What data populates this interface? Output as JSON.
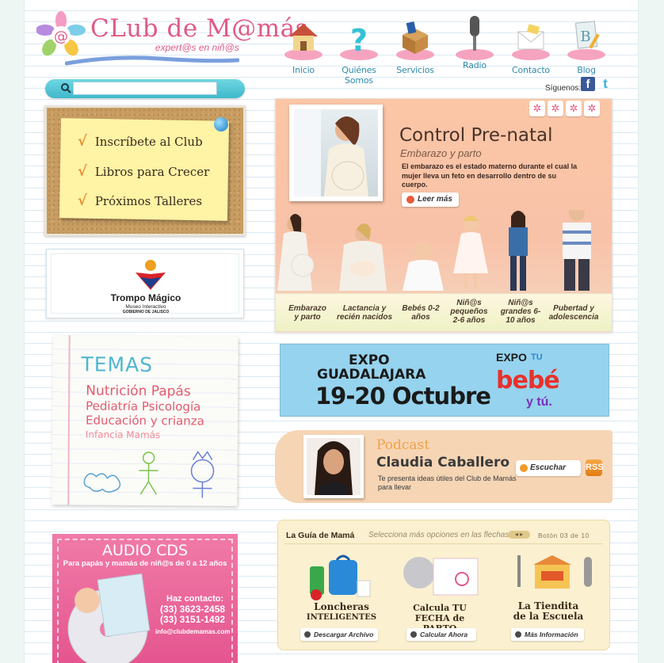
{
  "header": {
    "logo_title": "CLub de M@más",
    "logo_tagline": "expert@s en niñ@s",
    "nav": [
      {
        "label": "Inicio",
        "icon": "house-icon"
      },
      {
        "label": "Quiénes Somos",
        "icon": "question-mark-icon"
      },
      {
        "label": "Servicios",
        "icon": "box-icon"
      },
      {
        "label": "Radio",
        "icon": "microphone-icon"
      },
      {
        "label": "Contacto",
        "icon": "envelope-icon"
      },
      {
        "label": "Blog",
        "icon": "notebook-icon"
      }
    ]
  },
  "search": {
    "placeholder": "",
    "value": ""
  },
  "social": {
    "label": "Síguenos:",
    "facebook": "f",
    "twitter": "t"
  },
  "bulletin": {
    "links": [
      "Inscríbete al Club",
      "Libros para Crecer",
      "Próximos Talleres"
    ],
    "check": "√"
  },
  "trompo": {
    "name": "Trompo Mágico",
    "subtitle": "Museo Interactivo",
    "subtitle2": "GOBIERNO DE JALISCO"
  },
  "temas": {
    "title": "TEMAS",
    "lines": [
      "Nutrición  Papás",
      "Pediatría  Psicología",
      "Educación y crianza",
      "Infancia  Mamás"
    ]
  },
  "audio": {
    "title": "AUDIO CDS",
    "subtitle": "Para papás y mamás de niñ@s de 0 a 12 años",
    "contact_label": "Haz contacto:",
    "phone1": "(33) 3623-2458",
    "phone2": "(33) 3151-1492",
    "email": "info@clubdemamas.com"
  },
  "hero": {
    "title": "Control Pre-natal",
    "subtitle": "Embarazo y parto",
    "description": "El embarazo es el estado materno durante el cual la mujer lleva un feto en desarrollo dentro de su cuerpo.",
    "button": "Leer más",
    "stages": [
      "Embarazo y parto",
      "Lactancia y recién nacidos",
      "Bebés 0-2 años",
      "Niñ@s pequeños 2-6 años",
      "Niñ@s grandes 6-10 años",
      "Pubertad y adolescencia"
    ]
  },
  "expo": {
    "line1": "EXPO",
    "line2": "GUADALAJARA",
    "date": "19-20 Octubre",
    "logo_top": "EXPO",
    "logo_mid": "TU",
    "logo_bebe": "bebé",
    "logo_tu": "y tú."
  },
  "podcast": {
    "label": "Podcast",
    "name": "Claudia Caballero",
    "description": "Te presenta ideas útiles del Club de Mamás para llevar",
    "button": "Escuchar",
    "rss": "RSS"
  },
  "guide": {
    "title": "La Guía de Mamá",
    "hint": "Selecciona más opciones en las flechas",
    "counter_prefix": "Botón",
    "current": "03",
    "of": "de",
    "total": "10",
    "cards": [
      {
        "title1": "Loncheras",
        "title2": "INTELIGENTES",
        "button": "Descargar Archivo"
      },
      {
        "title1": "Calcula TU",
        "title2": "FECHA de PARTO",
        "button": "Calcular Ahora"
      },
      {
        "title1": "La Tiendita",
        "title2": "de la Escuela",
        "button": "Más Información"
      }
    ]
  },
  "colors": {
    "brand_pink": "#e05a86",
    "accent_cyan": "#3fb8cb",
    "nav_text": "#2e8aa8",
    "hero_bg": "#fbc6a6"
  }
}
